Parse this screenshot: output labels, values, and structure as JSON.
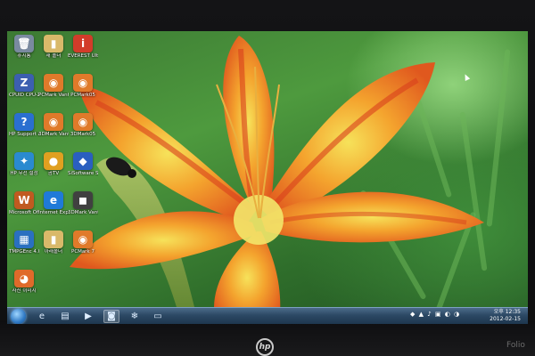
{
  "desktop": {
    "icons": [
      {
        "label": "휴지통",
        "glyph": "🗑",
        "color": "#7a8aa0"
      },
      {
        "label": "새 폴더",
        "glyph": "▮",
        "color": "#d9b96a"
      },
      {
        "label": "EVEREST Ultima",
        "glyph": "i",
        "color": "#d23c2a"
      },
      {
        "label": "CPUID CPU-Z",
        "glyph": "Z",
        "color": "#3c5fb0"
      },
      {
        "label": "PCMark Vantage...",
        "glyph": "◉",
        "color": "#e07a2a"
      },
      {
        "label": "PCMark05",
        "glyph": "◉",
        "color": "#e07a2a"
      },
      {
        "label": "HP Support Assistant",
        "glyph": "?",
        "color": "#2a6fd0"
      },
      {
        "label": "3DMark Vantage",
        "glyph": "◉",
        "color": "#e07a2a"
      },
      {
        "label": "3DMark05",
        "glyph": "◉",
        "color": "#e07a2a"
      },
      {
        "label": "HP 무선 설정",
        "glyph": "✦",
        "color": "#2a8ad0"
      },
      {
        "label": "곰TV",
        "glyph": "●",
        "color": "#e0a020"
      },
      {
        "label": "SiSoftware Sandra Li...",
        "glyph": "◆",
        "color": "#2a5fc0"
      },
      {
        "label": "Microsoft Office Wo...",
        "glyph": "W",
        "color": "#c05a20"
      },
      {
        "label": "Internet Explorer",
        "glyph": "e",
        "color": "#1f7ad8"
      },
      {
        "label": "3DMark Vantage",
        "glyph": "◼",
        "color": "#404040"
      },
      {
        "label": "TMPGEnc 4.0 XPres...",
        "glyph": "▦",
        "color": "#2a70c0"
      },
      {
        "label": "아래폴더",
        "glyph": "▮",
        "color": "#d9b96a"
      },
      {
        "label": "PCMark 7",
        "glyph": "◉",
        "color": "#e07a2a"
      },
      {
        "label": "사진 이미지",
        "glyph": "◕",
        "color": "#e06a2a"
      }
    ]
  },
  "taskbar": {
    "clock_time": "오후 12:35",
    "clock_date": "2012-02-15",
    "tray_icons": "◆ ▲ ♪ ▣ ◐ ◑",
    "buttons": [
      {
        "name": "ie",
        "glyph": "e"
      },
      {
        "name": "explorer",
        "glyph": "▤"
      },
      {
        "name": "media",
        "glyph": "▶"
      },
      {
        "name": "camera",
        "glyph": "◙"
      },
      {
        "name": "snowflake",
        "glyph": "❄"
      },
      {
        "name": "window",
        "glyph": "▭"
      }
    ]
  },
  "bezel": {
    "logo": "hp",
    "model": "Folio"
  }
}
